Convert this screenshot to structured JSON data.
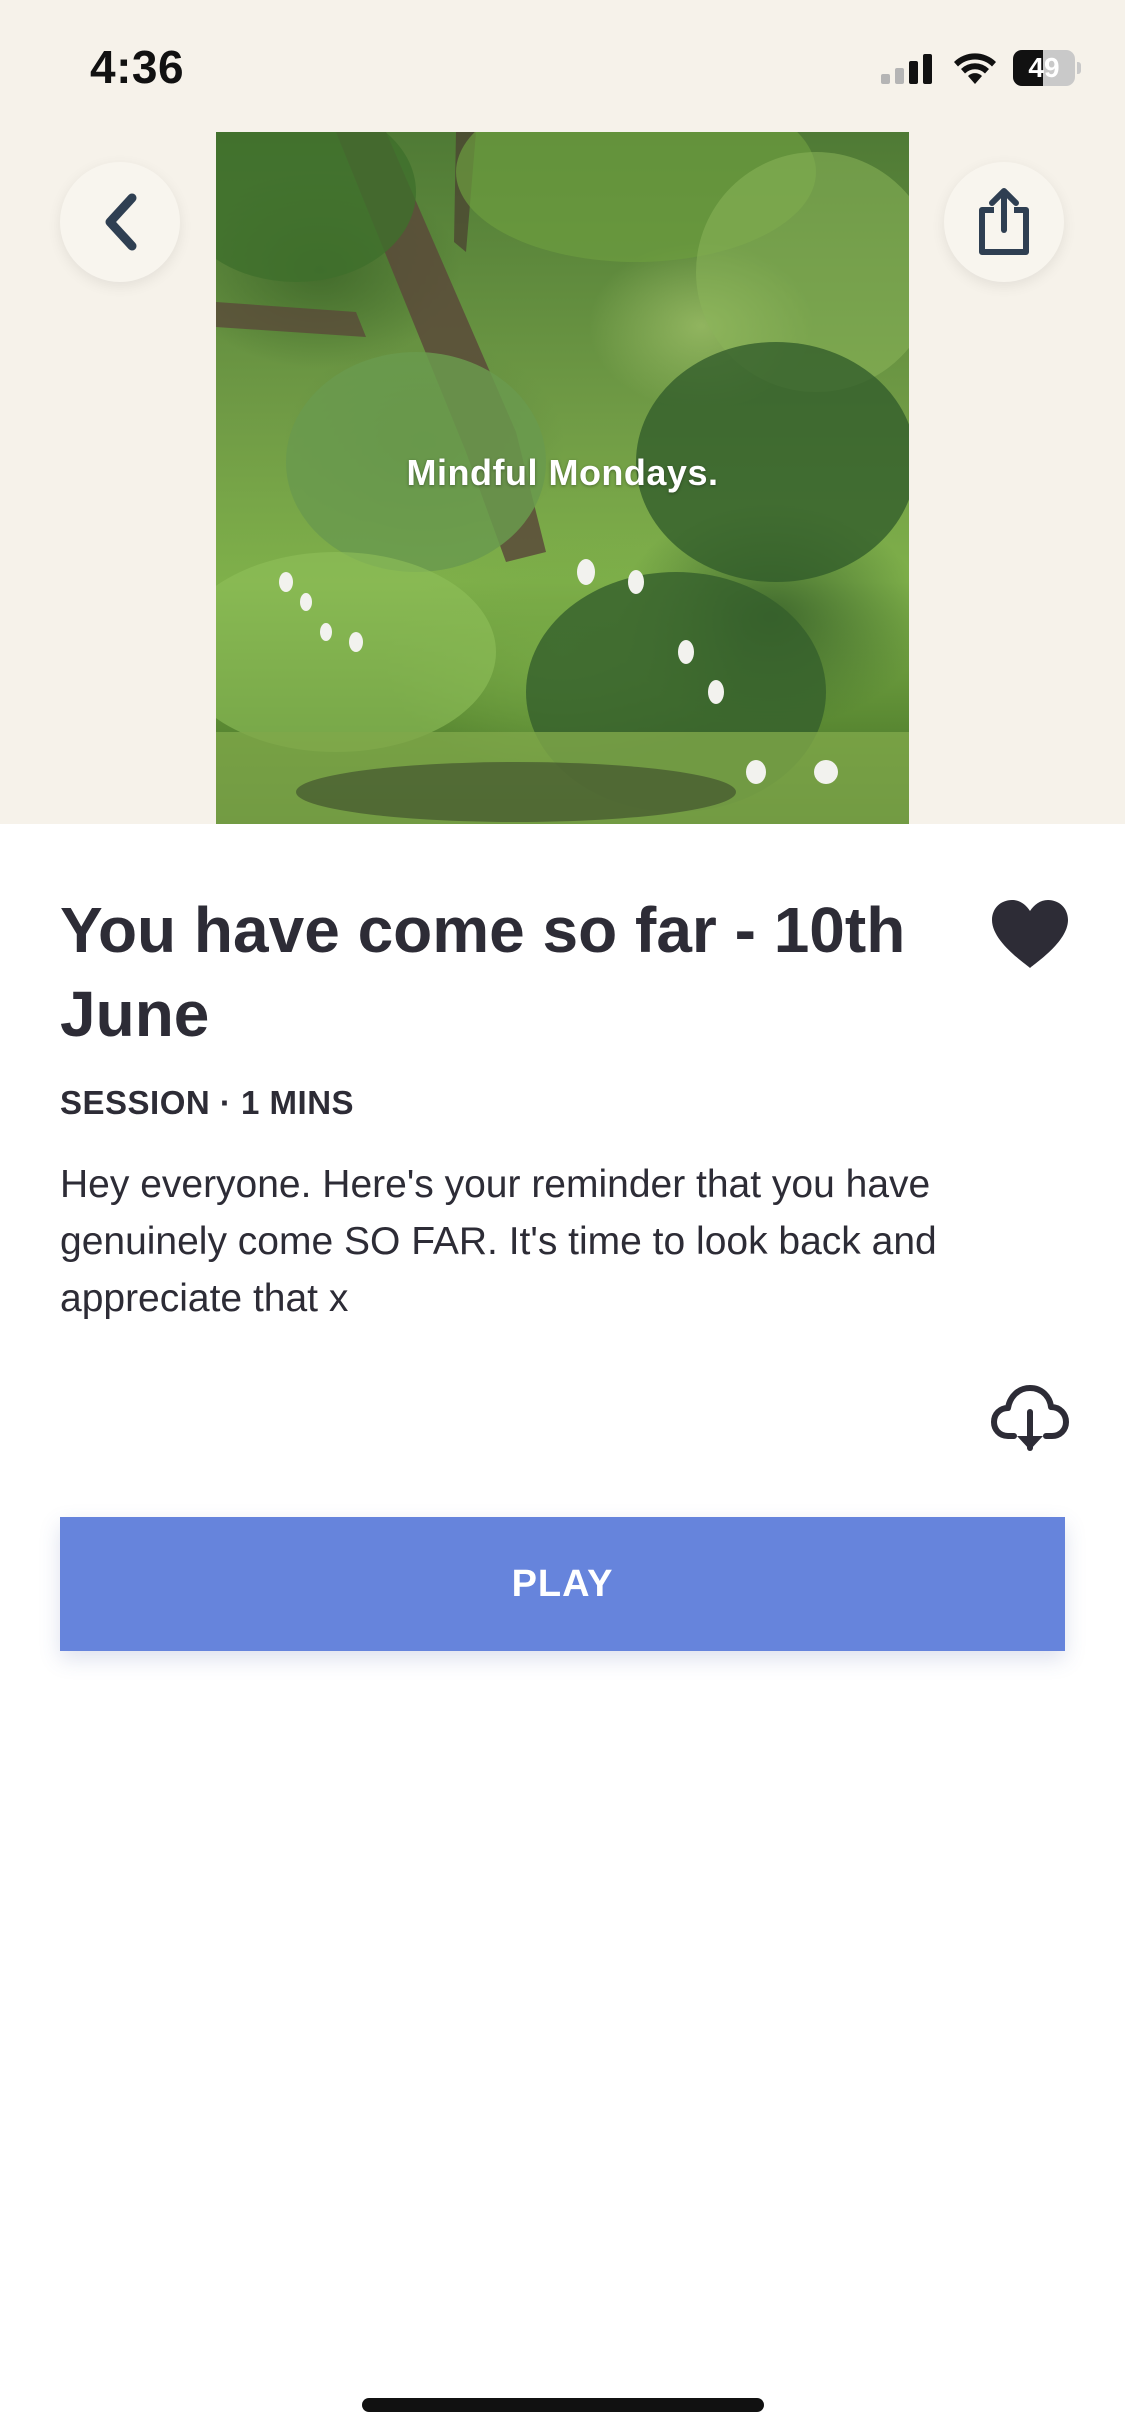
{
  "status_bar": {
    "time": "4:36",
    "battery_level": "49",
    "battery_fraction": 0.49,
    "icons": [
      "cellular-signal-icon",
      "wifi-icon",
      "battery-icon"
    ]
  },
  "header": {
    "back_icon": "chevron-left-icon",
    "share_icon": "share-icon"
  },
  "cover": {
    "title": "Mindful Mondays."
  },
  "session": {
    "title": "You have come so far - 10th June",
    "meta": "SESSION · 1 MINS",
    "description": "Hey everyone. Here's your reminder that you have genuinely come SO FAR. It's time to look back and appreciate that x",
    "favorite_icon": "heart-icon",
    "download_icon": "cloud-download-icon",
    "play_label": "PLAY"
  },
  "colors": {
    "accent": "#6684dc",
    "background_top": "#f6f2ea",
    "text": "#2d2c36"
  }
}
